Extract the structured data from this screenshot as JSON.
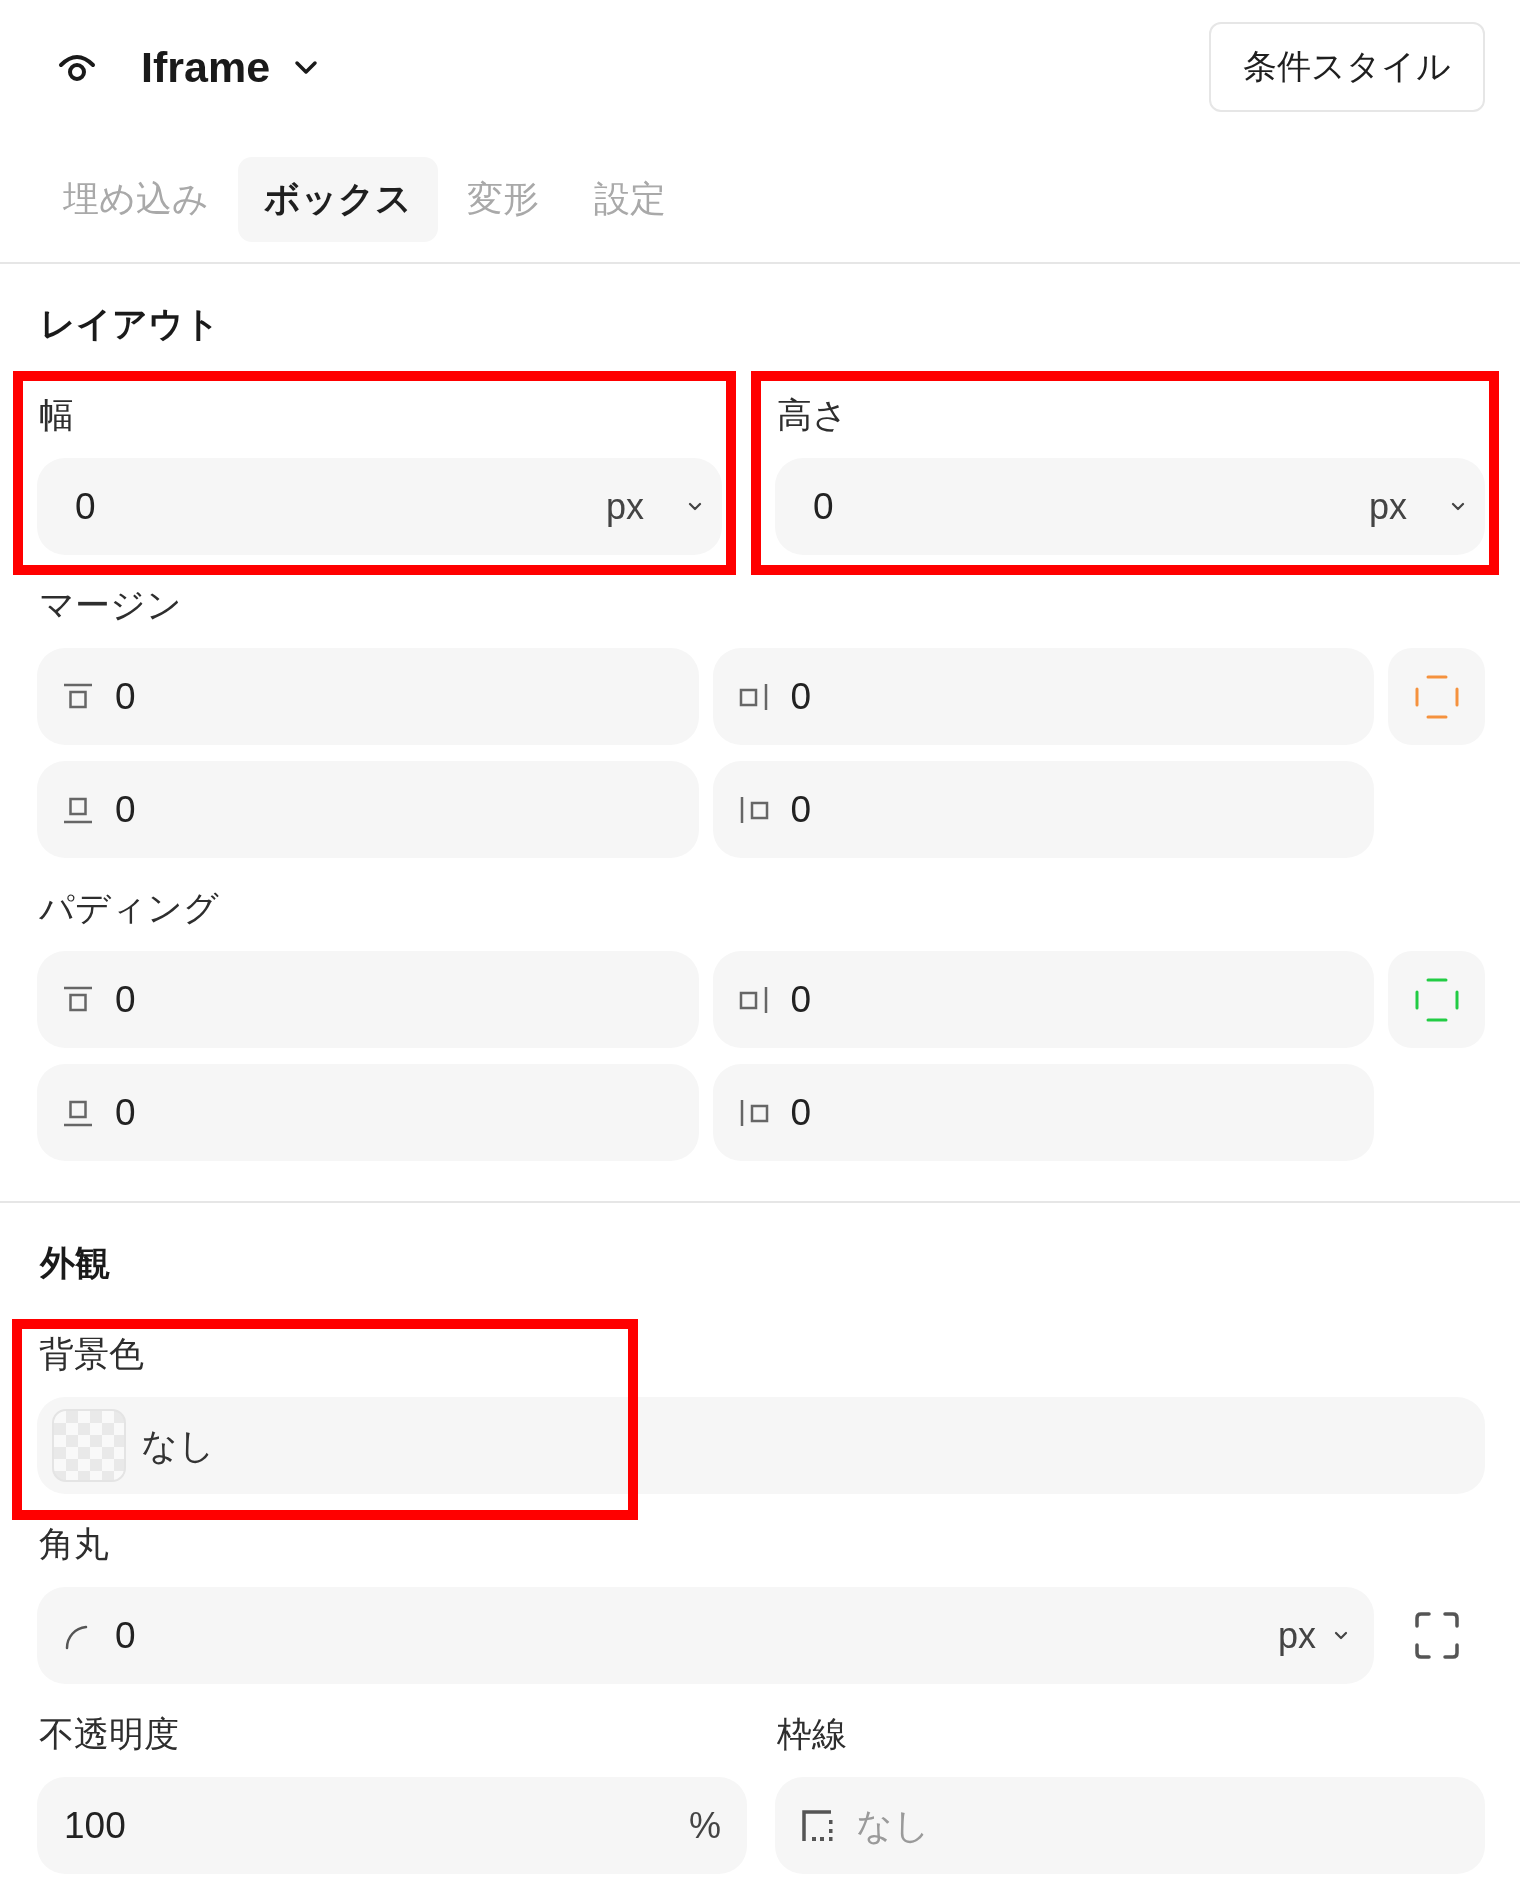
{
  "header": {
    "title": "Iframe",
    "button": "条件スタイル"
  },
  "tabs": [
    {
      "label": "埋め込み",
      "selected": false
    },
    {
      "label": "ボックス",
      "selected": true
    },
    {
      "label": "変形",
      "selected": false
    },
    {
      "label": "設定",
      "selected": false
    }
  ],
  "layout": {
    "heading": "レイアウト",
    "size_fields": [
      {
        "label": "幅",
        "value": "0",
        "unit": "px",
        "highlighted": true
      },
      {
        "label": "高さ",
        "value": "0",
        "unit": "px",
        "highlighted": true
      }
    ],
    "spacing_groups": [
      {
        "label": "マージン",
        "color": "#f5923e",
        "fields": [
          {
            "kind": "top",
            "value": "0"
          },
          {
            "kind": "right",
            "value": "0"
          },
          {
            "kind": "bottom",
            "value": "0"
          },
          {
            "kind": "left",
            "value": "0"
          }
        ]
      },
      {
        "label": "パディング",
        "color": "#22cc44",
        "fields": [
          {
            "kind": "top",
            "value": "0"
          },
          {
            "kind": "right",
            "value": "0"
          },
          {
            "kind": "bottom",
            "value": "0"
          },
          {
            "kind": "left",
            "value": "0"
          }
        ]
      }
    ]
  },
  "appearance": {
    "heading": "外観",
    "background_color": {
      "label": "背景色",
      "value": "なし",
      "highlighted": true
    },
    "corner_radius": {
      "label": "角丸",
      "value": "0",
      "unit": "px"
    },
    "opacity": {
      "label": "不透明度",
      "value": "100",
      "unit": "%"
    },
    "border": {
      "label": "枠線",
      "placeholder": "なし"
    }
  }
}
